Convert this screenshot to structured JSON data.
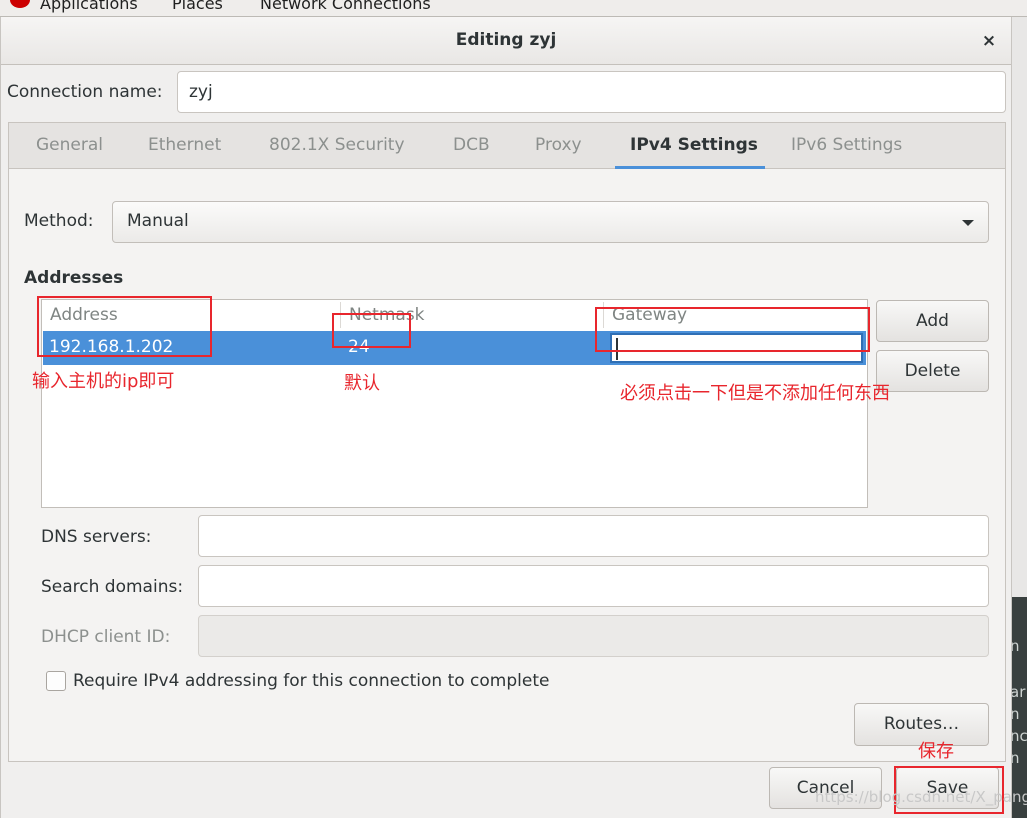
{
  "desktop": {
    "menu": [
      "Applications",
      "Places",
      "Network Connections"
    ],
    "right_fragments": [
      "n",
      "ar",
      "n",
      "nc",
      "n"
    ]
  },
  "dialog": {
    "title": "Editing zyj",
    "close_glyph": "×",
    "connection_name_label": "Connection name:",
    "connection_name_value": "zyj",
    "tabs": [
      "General",
      "Ethernet",
      "802.1X Security",
      "DCB",
      "Proxy",
      "IPv4 Settings",
      "IPv6 Settings"
    ],
    "active_tab": "IPv4 Settings",
    "method_label": "Method:",
    "method_value": "Manual",
    "addresses_heading": "Addresses",
    "columns": [
      "Address",
      "Netmask",
      "Gateway"
    ],
    "rows": [
      {
        "address": "192.168.1.202",
        "netmask": "24",
        "gateway": ""
      }
    ],
    "add_button": "Add",
    "delete_button": "Delete",
    "dns_label": "DNS servers:",
    "dns_value": "",
    "search_label": "Search domains:",
    "search_value": "",
    "dhcp_label": "DHCP client ID:",
    "dhcp_value": "",
    "require_label": "Require IPv4 addressing for this connection to complete",
    "require_checked": false,
    "routes_button": "Routes…",
    "cancel_button": "Cancel",
    "save_button": "Save"
  },
  "annotations": {
    "address_note": "输入主机的ip即可",
    "netmask_note": "默认",
    "gateway_note": "必须点击一下但是不添加任何东西",
    "save_note": "保存"
  },
  "watermark": "https://blog.csdn.net/X_pang",
  "colors": {
    "selection": "#4a90d9",
    "annotation": "#e8262d",
    "active_tab_underline": "#4a90d9"
  }
}
